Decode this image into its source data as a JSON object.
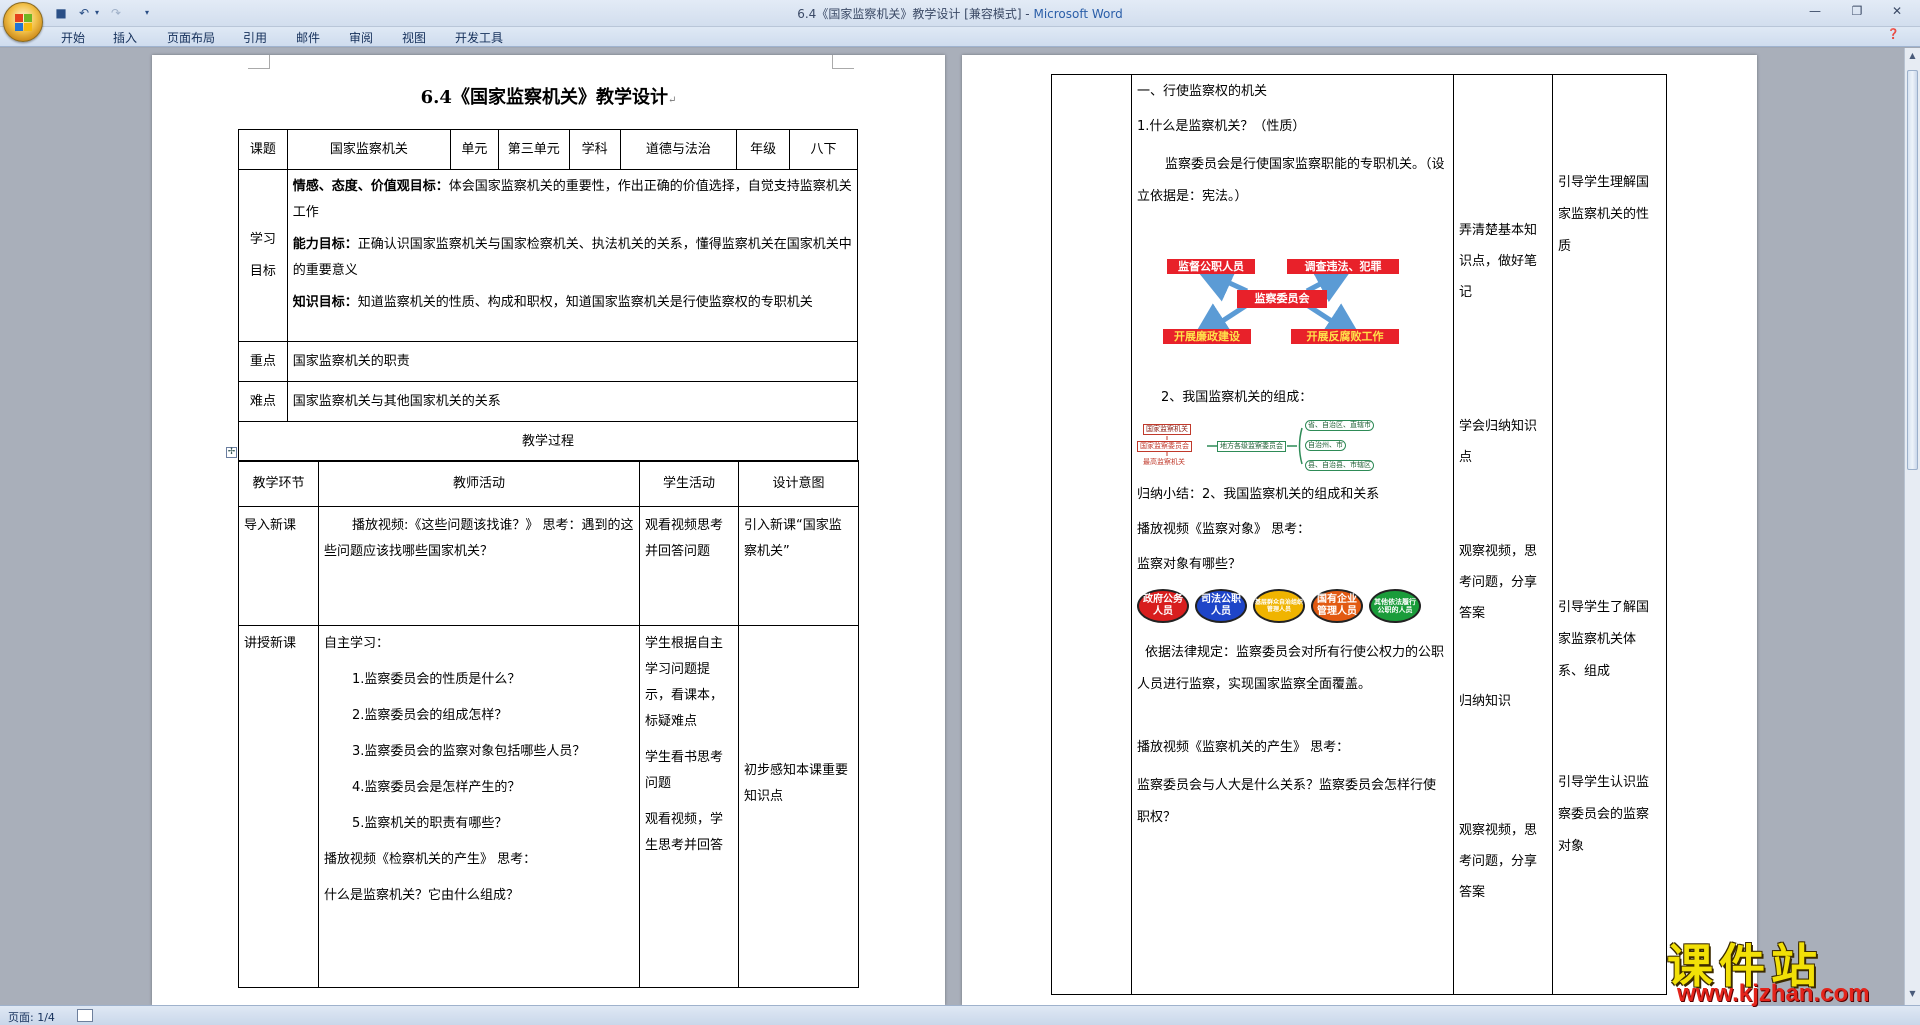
{
  "window": {
    "doc_name": "6.4《国家监察机关》教学设计 [兼容模式] - ",
    "app_name": "Microsoft Word"
  },
  "ribbon": {
    "tabs": [
      "开始",
      "插入",
      "页面布局",
      "引用",
      "邮件",
      "审阅",
      "视图",
      "开发工具"
    ]
  },
  "status": {
    "page": "页面: 1/4"
  },
  "watermark": {
    "cn": "课件站",
    "url": "www.kjzhan.com"
  },
  "page1": {
    "title": "6.4《国家监察机关》教学设计",
    "info": {
      "topic_label": "课题",
      "topic": "国家监察机关",
      "unit_label": "单元",
      "unit": "第三单元",
      "subject_label": "学科",
      "subject": "道德与法治",
      "grade_label": "年级",
      "grade": "八下"
    },
    "goals_label": "学习目标",
    "goals": [
      {
        "head": "情感、态度、价值观目标：",
        "text": "体会国家监察机关的重要性，作出正确的价值选择，自觉支持监察机关工作"
      },
      {
        "head": "能力目标：",
        "text": "正确认识国家监察机关与国家检察机关、执法机关的关系，懂得监察机关在国家机关中的重要意义"
      },
      {
        "head": "知识目标：",
        "text": "知道监察机关的性质、构成和职权，知道国家监察机关是行使监察权的专职机关"
      }
    ],
    "key_label": "重点",
    "key": "国家监察机关的职责",
    "difficulty_label": "难点",
    "difficulty": "国家监察机关与其他国家机关的关系",
    "process_title": "教学过程",
    "headers": [
      "教学环节",
      "教师活动",
      "学生活动",
      "设计意图"
    ],
    "row1": {
      "stage": "导入新课",
      "teacher": "播放视频:《这些问题该找谁？》 思考：遇到的这些问题应该找哪些国家机关？",
      "student": "观看视频思考并回答问题",
      "intent": "引入新课“国家监察机关”"
    },
    "row2": {
      "stage": "讲授新课",
      "teacher_intro": "自主学习：",
      "questions": [
        "1.监察委员会的性质是什么？",
        "2.监察委员会的组成怎样？",
        "3.监察委员会的监察对象包括哪些人员？",
        "4.监察委员会是怎样产生的？",
        "5.监察机关的职责有哪些？"
      ],
      "video": "播放视频《检察机关的产生》 思考：",
      "question_last": "什么是监察机关？它由什么组成？",
      "student": [
        "学生根据自主学习问题提示，看课本，标疑难点",
        "学生看书思考问题",
        "观看视频，学生思考并回答"
      ],
      "intent": "初步感知本课重要知识点"
    }
  },
  "page2": {
    "teacher": {
      "heading": "一、行使监察权的机关",
      "q1": "1.什么是监察机关？（性质）",
      "answer": "监察委员会是行使国家监察职能的专职机关。（设立依据是：宪法。）",
      "diagram1": {
        "center": "监察委员会",
        "top_left": "监督公职人员",
        "top_right": "调查违法、犯罪",
        "bottom_left": "开展廉政建设",
        "bottom_right": "开展反腐败工作"
      },
      "q2": "2、我国监察机关的组成：",
      "diagram2": {
        "left_top": "国家监察机关",
        "left_mid": "国家监察委员会",
        "left_bottom": "最高监察机关",
        "middle": "地方各级监察委员会",
        "right": [
          "省、自治区、直辖市",
          "自治州、市",
          "县、自治县、市辖区"
        ]
      },
      "summary": "归纳小结：2、我国监察机关的组成和关系",
      "video1": "播放视频《监察对象》 思考：",
      "q3": "监察对象有哪些？",
      "circles": [
        "政府公务人员",
        "司法公职人员",
        "基层群众自治组织管理人员",
        "国有企业管理人员",
        "其他依法履行公职的人员"
      ],
      "law": "依据法律规定：监察委员会对所有行使公权力的公职人员进行监察，实现国家监察全面覆盖。",
      "video2": "播放视频《监察机关的产生》 思考：",
      "q4": "监察委员会与人大是什么关系？监察委员会怎样行使职权？"
    },
    "student": [
      "弄清楚基本知识点，做好笔记",
      "学会归纳知识点",
      "观察视频，思考问题，分享答案",
      "归纳知识",
      "观察视频，思考问题，分享答案"
    ],
    "intent": [
      "引导学生理解国家监察机关的性质",
      "引导学生了解国家监察机关体系、组成",
      "引导学生认识监察委员会的监察对象"
    ]
  },
  "colors": {
    "accent": "#2a5ea8",
    "red": "#e8212a",
    "circle_colors": [
      "#d81e1e",
      "#1e45c8",
      "#f0b400",
      "#e25a12",
      "#1a9c3a"
    ]
  }
}
